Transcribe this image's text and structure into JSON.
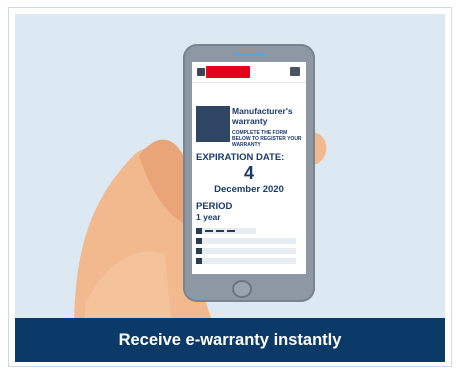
{
  "colors": {
    "accent": "#e2001a",
    "navy": "#0b3a68",
    "text_primary": "#1b3a6b",
    "background": "#dce9f3"
  },
  "phone_screen": {
    "brand_badge": "",
    "title": "Manufacturer's warranty",
    "hint": "COMPLETE THE FORM BELOW TO REGISTER YOUR WARRANTY",
    "expiration_label": "EXPIRATION DATE:",
    "expiration_day": "4",
    "expiration_rest": "December 2020",
    "period_label": "PERIOD",
    "period_value": "1 year"
  },
  "icons": {
    "menu": "menu-icon",
    "action": "grid-icon",
    "home": "home-button-icon"
  },
  "caption": "Receive e-warranty instantly"
}
